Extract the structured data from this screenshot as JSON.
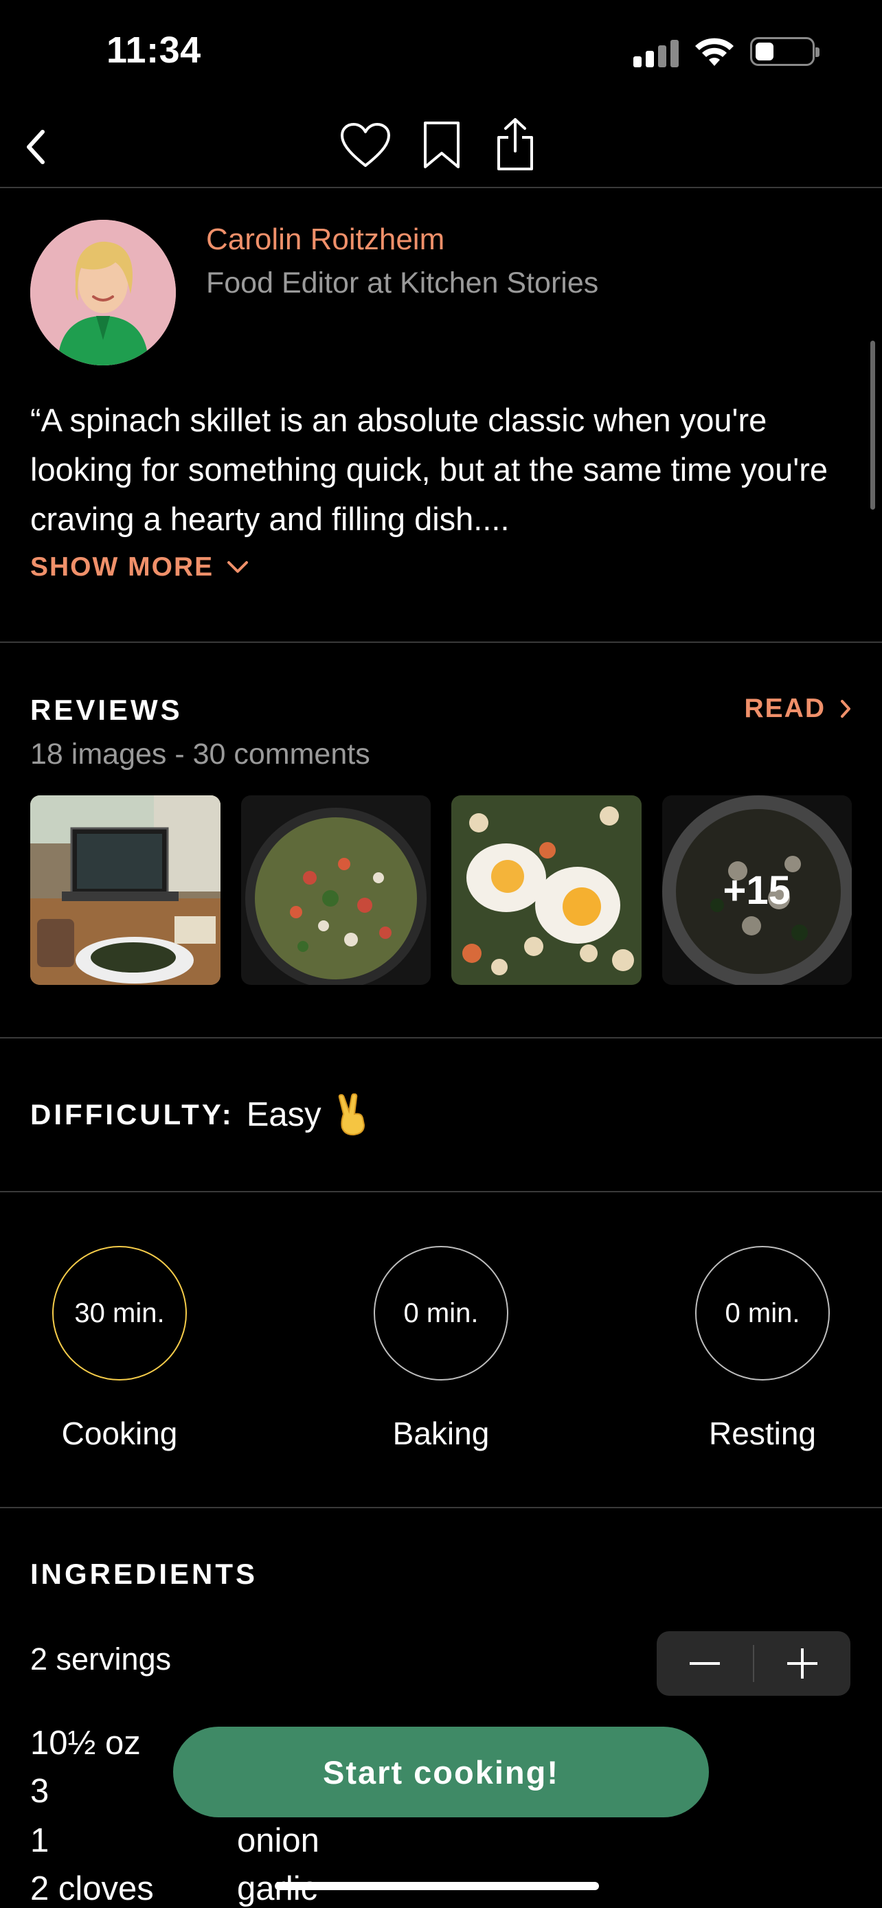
{
  "status_bar": {
    "time": "11:34"
  },
  "nav": {
    "back_icon": "chevron-left-icon",
    "heart_icon": "heart-icon",
    "bookmark_icon": "bookmark-icon",
    "share_icon": "share-icon"
  },
  "author": {
    "name": "Carolin Roitzheim",
    "role": "Food Editor at Kitchen Stories",
    "quote": "“A spinach skillet is an absolute classic when you're looking for something quick, but at the same time you're craving a hearty and filling dish....",
    "show_more": "SHOW MORE"
  },
  "reviews": {
    "heading": "REVIEWS",
    "read_label": "READ",
    "meta": "18 images - 30 comments",
    "more_count": "+15"
  },
  "difficulty": {
    "label": "DIFFICULTY:",
    "value": "Easy",
    "emoji": "✌️"
  },
  "times": [
    {
      "value": "30 min.",
      "label": "Cooking"
    },
    {
      "value": "0 min.",
      "label": "Baking"
    },
    {
      "value": "0 min.",
      "label": "Resting"
    }
  ],
  "ingredients": {
    "heading": "INGREDIENTS",
    "servings": "2 servings",
    "rows": [
      {
        "amount": "10½ oz",
        "name": ""
      },
      {
        "amount": "3",
        "name": ""
      },
      {
        "amount": "1",
        "name": "onion"
      },
      {
        "amount": "2 cloves",
        "name": "garlic"
      }
    ]
  },
  "cta": {
    "label": "Start cooking!"
  },
  "colors": {
    "accent": "#f0906a",
    "cta": "#3f8a66",
    "active_ring": "#f5cc4a"
  }
}
